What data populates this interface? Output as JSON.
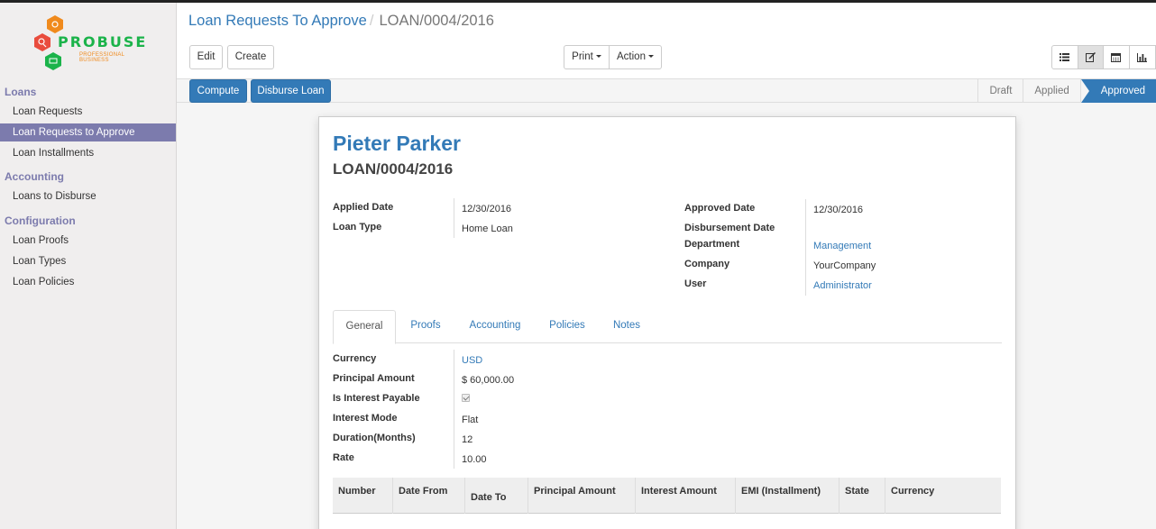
{
  "brand": {
    "name": "PROBUSE",
    "tagline": "PROFESSIONAL BUSINESS"
  },
  "sidebar": {
    "sections": [
      {
        "heading": "Loans",
        "items": [
          "Loan Requests",
          "Loan Requests to Approve",
          "Loan Installments"
        ]
      },
      {
        "heading": "Accounting",
        "items": [
          "Loans to Disburse"
        ]
      },
      {
        "heading": "Configuration",
        "items": [
          "Loan Proofs",
          "Loan Types",
          "Loan Policies"
        ]
      }
    ],
    "active_item": "Loan Requests to Approve"
  },
  "breadcrumb": {
    "parent": "Loan Requests To Approve",
    "separator": "/",
    "current": "LOAN/0004/2016"
  },
  "buttons": {
    "edit": "Edit",
    "create": "Create",
    "print": "Print",
    "action": "Action"
  },
  "views": [
    "list-icon",
    "form-icon",
    "calendar-icon",
    "graph-icon"
  ],
  "statusbar": {
    "buttons": {
      "compute": "Compute",
      "disburse": "Disburse Loan"
    },
    "stages": [
      "Draft",
      "Applied",
      "Approved"
    ],
    "current_stage": "Approved"
  },
  "record": {
    "employee": "Pieter Parker",
    "reference": "LOAN/0004/2016",
    "left": {
      "applied_date_label": "Applied Date",
      "applied_date": "12/30/2016",
      "loan_type_label": "Loan Type",
      "loan_type": "Home Loan"
    },
    "right": {
      "approved_date_label": "Approved Date",
      "approved_date": "12/30/2016",
      "disbursement_date_label": "Disbursement Date",
      "disbursement_date": "",
      "department_label": "Department",
      "department": "Management",
      "company_label": "Company",
      "company": "YourCompany",
      "user_label": "User",
      "user": "Administrator"
    }
  },
  "tabs": [
    "General",
    "Proofs",
    "Accounting",
    "Policies",
    "Notes"
  ],
  "active_tab": "General",
  "general": {
    "currency_label": "Currency",
    "currency": "USD",
    "principal_label": "Principal Amount",
    "principal": "$ 60,000.00",
    "interest_payable_label": "Is Interest Payable",
    "interest_payable": true,
    "interest_mode_label": "Interest Mode",
    "interest_mode": "Flat",
    "duration_label": "Duration(Months)",
    "duration": "12",
    "rate_label": "Rate",
    "rate": "10.00"
  },
  "installments_table": {
    "columns": [
      "Number",
      "Date From",
      "Date To",
      "Principal Amount",
      "Interest Amount",
      "EMI (Installment)",
      "State",
      "Currency"
    ]
  },
  "colors": {
    "primary": "#337ab7",
    "sidebar_accent": "#7c7bad",
    "brand_green": "#1bb34a",
    "brand_orange": "#f08a1c"
  }
}
